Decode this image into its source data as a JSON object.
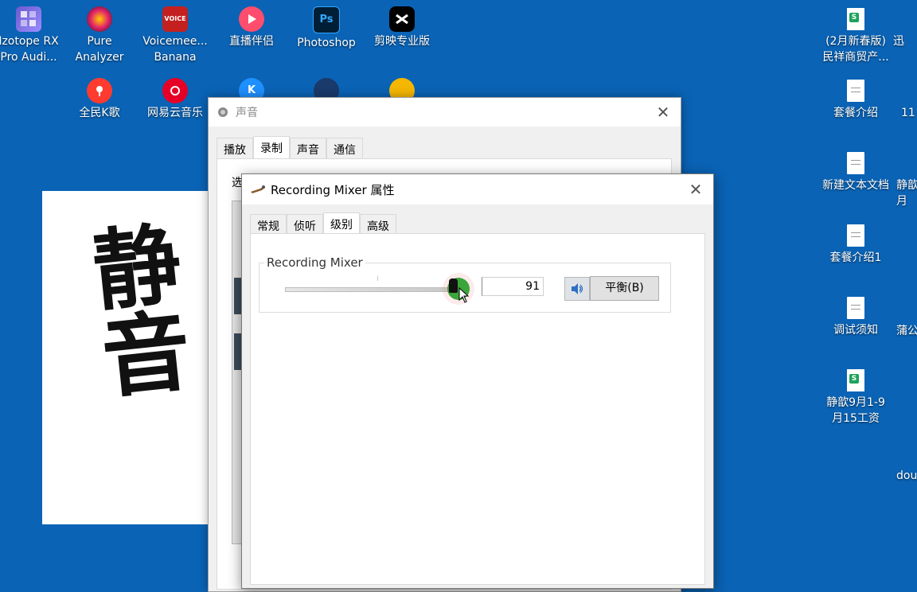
{
  "desktop": {
    "icons": [
      {
        "label": "Izotope RX\nPro Audi...",
        "icon": "izotope-icon"
      },
      {
        "label": "Pure\nAnalyzer",
        "icon": "pure-analyzer-icon"
      },
      {
        "label": "Voicemee...\nBanana",
        "icon": "voicemeeter-icon",
        "badge": "VOICE"
      },
      {
        "label": "直播伴侣",
        "icon": "live-companion-icon"
      },
      {
        "label": "Photoshop",
        "icon": "photoshop-icon",
        "badge": "Ps"
      },
      {
        "label": "剪映专业版",
        "icon": "capcut-icon"
      },
      {
        "label": "全民K歌",
        "icon": "quanmin-kge-icon"
      },
      {
        "label": "网易云音乐",
        "icon": "netease-music-icon"
      },
      {
        "label": "(2月新春版)\n民祥商贸产...",
        "icon": "spreadsheet-file-icon"
      },
      {
        "label": "套餐介绍",
        "icon": "text-file-icon"
      },
      {
        "label": "新建文本文档",
        "icon": "text-file-icon"
      },
      {
        "label": "套餐介绍1",
        "icon": "text-file-icon"
      },
      {
        "label": "调试须知",
        "icon": "text-file-icon"
      },
      {
        "label": "静歆9月1-9\n月15工资",
        "icon": "spreadsheet-file-icon"
      }
    ],
    "edge_labels": [
      "迅",
      "11",
      "静歆\n月",
      "蒲公",
      "dou"
    ],
    "calligraphy_text": "静音"
  },
  "sound_window": {
    "title": "声音",
    "tabs": [
      "播放",
      "录制",
      "声音",
      "通信"
    ],
    "active_tab": 1,
    "partial_text": "选"
  },
  "mixer_dialog": {
    "title": "Recording Mixer 属性",
    "tabs": [
      "常规",
      "侦听",
      "级别",
      "高级"
    ],
    "active_tab": 2,
    "group_label": "Recording Mixer",
    "level_value": "91",
    "slider_level": 0.91,
    "balance_button": "平衡(B)",
    "accent": "#3aa53a"
  }
}
